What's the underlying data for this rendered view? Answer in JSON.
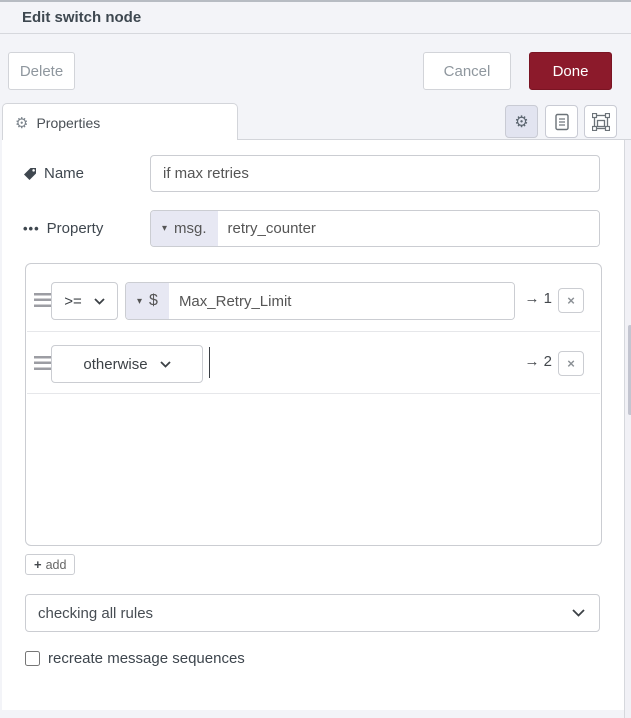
{
  "dialog": {
    "title": "Edit switch node",
    "delete_label": "Delete",
    "cancel_label": "Cancel",
    "done_label": "Done"
  },
  "tabs": {
    "properties_label": "Properties"
  },
  "form": {
    "name": {
      "label": "Name",
      "value": "if max retries"
    },
    "property": {
      "label": "Property",
      "type_label": "msg.",
      "value": "retry_counter"
    },
    "rules": [
      {
        "operator": ">=",
        "value_type": "$",
        "value": "Max_Retry_Limit",
        "output": "→ 1"
      },
      {
        "operator": "otherwise",
        "value": "",
        "output": "→ 2"
      }
    ],
    "add_label": "add",
    "rule_mode": "checking all rules",
    "recreate_label": "recreate message sequences"
  },
  "icons": {
    "gear": "⚙",
    "caret_down": "▾",
    "ellipsis": "•••",
    "close": "×",
    "plus": "+"
  },
  "colors": {
    "done_button_bg": "#8c1a2b",
    "typed_input_type_bg": "#e7e8f3",
    "active_tab_button_bg": "#e2e4f0"
  }
}
